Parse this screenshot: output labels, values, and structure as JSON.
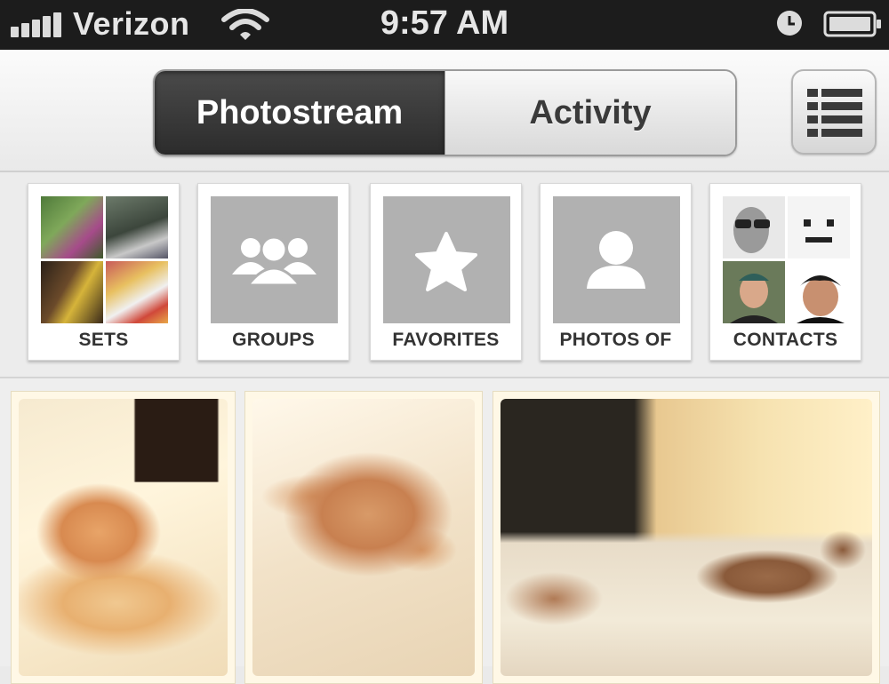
{
  "status_bar": {
    "carrier": "Verizon",
    "time": "9:57 AM",
    "signal_icon": "signal-bars-icon",
    "wifi_icon": "wifi-icon",
    "alarm_icon": "alarm-clock-icon",
    "battery_icon": "battery-icon"
  },
  "nav": {
    "segments": [
      {
        "label": "Photostream",
        "selected": true
      },
      {
        "label": "Activity",
        "selected": false
      }
    ],
    "menu_icon": "list-menu-icon"
  },
  "tiles": [
    {
      "label": "SETS",
      "icon": "sets-collage-image"
    },
    {
      "label": "GROUPS",
      "icon": "group-people-icon"
    },
    {
      "label": "FAVORITES",
      "icon": "star-icon"
    },
    {
      "label": "PHOTOS OF",
      "icon": "person-icon"
    },
    {
      "label": "CONTACTS",
      "icon": "contacts-avatars-image"
    }
  ],
  "photos": [
    {
      "subject": "kitten-sleeping-photo"
    },
    {
      "subject": "kitten-sleeping-photo"
    },
    {
      "subject": "kittens-on-bed-photo"
    }
  ],
  "colors": {
    "status_bar": "#1c1c1c",
    "segment_active": "#2c2c2c",
    "tile_placeholder": "#b1b1b1"
  }
}
